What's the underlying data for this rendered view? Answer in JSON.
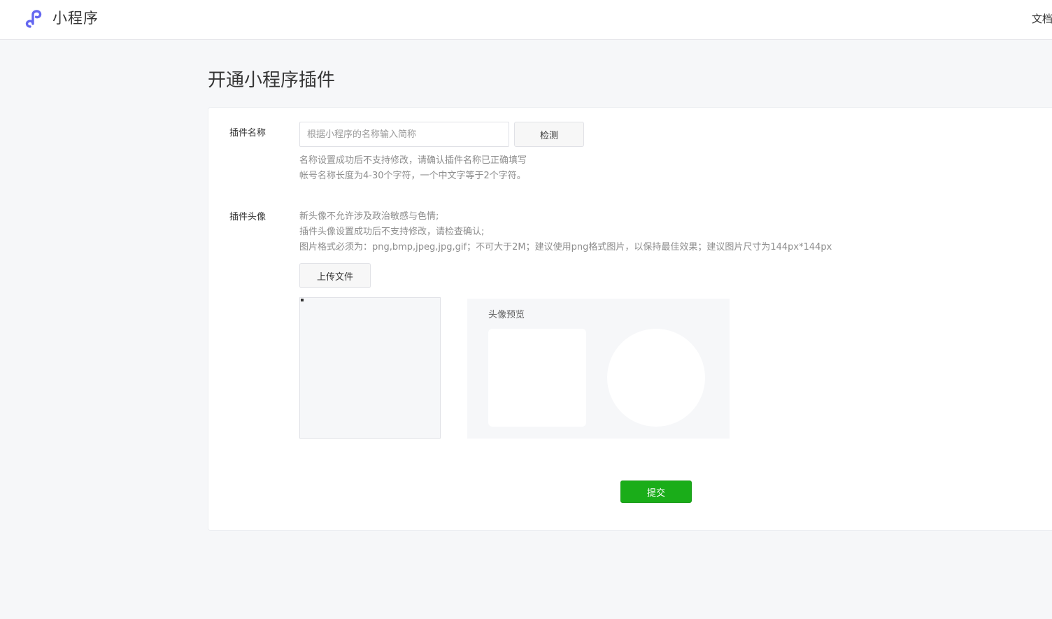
{
  "header": {
    "logo_icon": "miniprogram-logo-icon",
    "brand": "小程序",
    "docs_link": "文档"
  },
  "page": {
    "title": "开通小程序插件"
  },
  "form": {
    "name_field": {
      "label": "插件名称",
      "value": "",
      "placeholder": "根据小程序的名称输入简称",
      "check_button": "检测",
      "hints": [
        "名称设置成功后不支持修改，请确认插件名称已正确填写",
        "帐号名称长度为4-30个字符，一个中文字等于2个字符。"
      ]
    },
    "avatar_field": {
      "label": "插件头像",
      "hints": [
        "新头像不允许涉及政治敏感与色情;",
        "插件头像设置成功后不支持修改，请检查确认;",
        "图片格式必须为：png,bmp,jpeg,jpg,gif；不可大于2M；建议使用png格式图片，以保持最佳效果；建议图片尺寸为144px*144px"
      ],
      "upload_button": "上传文件",
      "preview_title": "头像预览"
    },
    "submit_button": "提交"
  },
  "colors": {
    "primary_green": "#1aad19",
    "logo_purple": "#6467f0",
    "background": "#f6f7f9"
  }
}
